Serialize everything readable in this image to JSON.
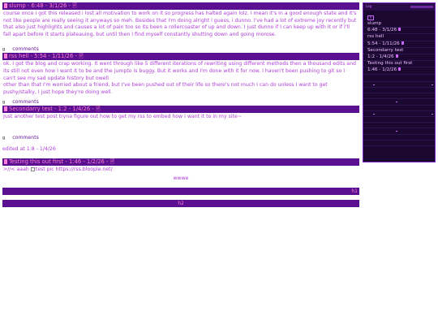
{
  "posts": [
    {
      "title": "slump - 6:48 - 3/1/26 - 🖹",
      "body": "course once i got this released i lost all motivation to work on it so progress has halted again lolz. I mean it's in a good enough state and it's not like people are really seeing it anyways so meh. Besides that I'm doing alright i guess, i dunno. I've had a lot of extreme joy recently but that also just highlights and causes a lot of pain too so its been a rollercoaster of up and down. I just dunno if I can keep up with it or if I'll fall apart before it starts plateauing, but until then I find myself constantly shutting down and going morose.",
      "comments": "comments"
    },
    {
      "title": "rss hell - 5:54 - 1/11/26 - 🖹",
      "body": "ok. I got the blog and crap working. It went through like 5 different iterations of rewriting using different methods then a thousand edits and its still not even how I want it to be and the jumpto is buggy. But it works and I'm done with it for now. I haven't been pushing to git so I can't see my sad update history but owell\nother than that I'm worried about a friend, but I've been pushed out of their life so there's not much I can do unless I want to get pushy/stalky, I just hope they're doing well.",
      "comments": "comments"
    },
    {
      "title": "Secondarry test - 1:2 - 1/4/26 - 🖹",
      "body": "Just another test post tryna figure out how to get my rss to embed how I want it to in my site~",
      "comments": "comments",
      "edited": "edited at 1:8 - 1/4/26"
    },
    {
      "title": "Testing this out first - 1:46 - 1/2/26 - 🖹",
      "body_prefix": ">//< aaah",
      "img_alt": "test pic",
      "img_suffix": "https://rss.bloople.net/",
      "center": "wwwe"
    }
  ],
  "footer": {
    "h1": "h1",
    "h2": "h2"
  },
  "sidebar": {
    "top_label": "Log",
    "icon": "h",
    "items": [
      {
        "title": "slump",
        "date": "6:48 - 3/1/26"
      },
      {
        "title": "rss hell",
        "date": "5:54 - 1/11/26"
      },
      {
        "title": "Secondarry test",
        "date": "1:2 - 1/4/26"
      },
      {
        "title": "Testing this out first",
        "date": "1:46 - 1/2/26"
      }
    ]
  },
  "colors": {
    "bar": "#5a1090",
    "title_text": "#ff7fd8",
    "body_text": "#b040d8",
    "sidebar_bg": "#1a0830"
  }
}
